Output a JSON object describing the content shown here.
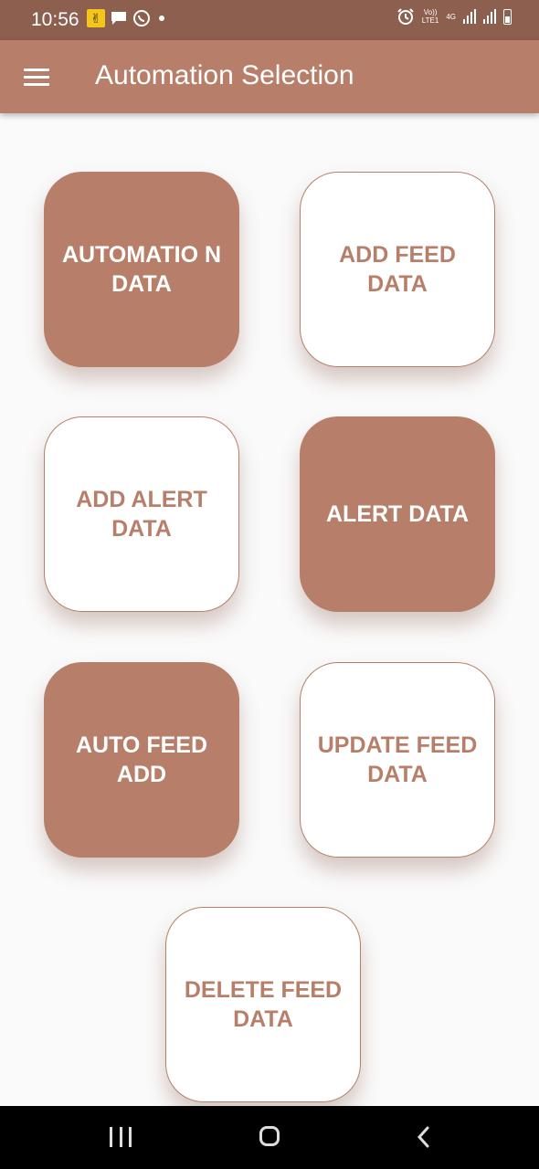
{
  "status_bar": {
    "time": "10:56",
    "left_icons": [
      "notification-app-icon",
      "message-icon",
      "whatsapp-icon",
      "dot-icon"
    ],
    "network_label_top": "Vo))",
    "network_label_bottom": "LTE1",
    "network_type": "4G",
    "right_icons": [
      "alarm-icon",
      "signal-icon",
      "signal-icon",
      "battery-icon"
    ]
  },
  "app_bar": {
    "menu_icon": "hamburger-menu-icon",
    "title": "Automation Selection"
  },
  "tiles": [
    {
      "label": "AUTOMATIO N DATA",
      "style": "filled"
    },
    {
      "label": "ADD FEED DATA",
      "style": "outline"
    },
    {
      "label": "ADD ALERT DATA",
      "style": "outline"
    },
    {
      "label": "ALERT DATA",
      "style": "filled"
    },
    {
      "label": "AUTO FEED ADD",
      "style": "filled"
    },
    {
      "label": "UPDATE FEED DATA",
      "style": "outline"
    },
    {
      "label": "DELETE FEED DATA",
      "style": "outline"
    }
  ],
  "nav_bar": {
    "icons": [
      "recent-apps-icon",
      "home-icon",
      "back-icon"
    ]
  },
  "colors": {
    "status_bar": "#8c5f4f",
    "accent": "#b77f69",
    "background": "#fafafa"
  }
}
